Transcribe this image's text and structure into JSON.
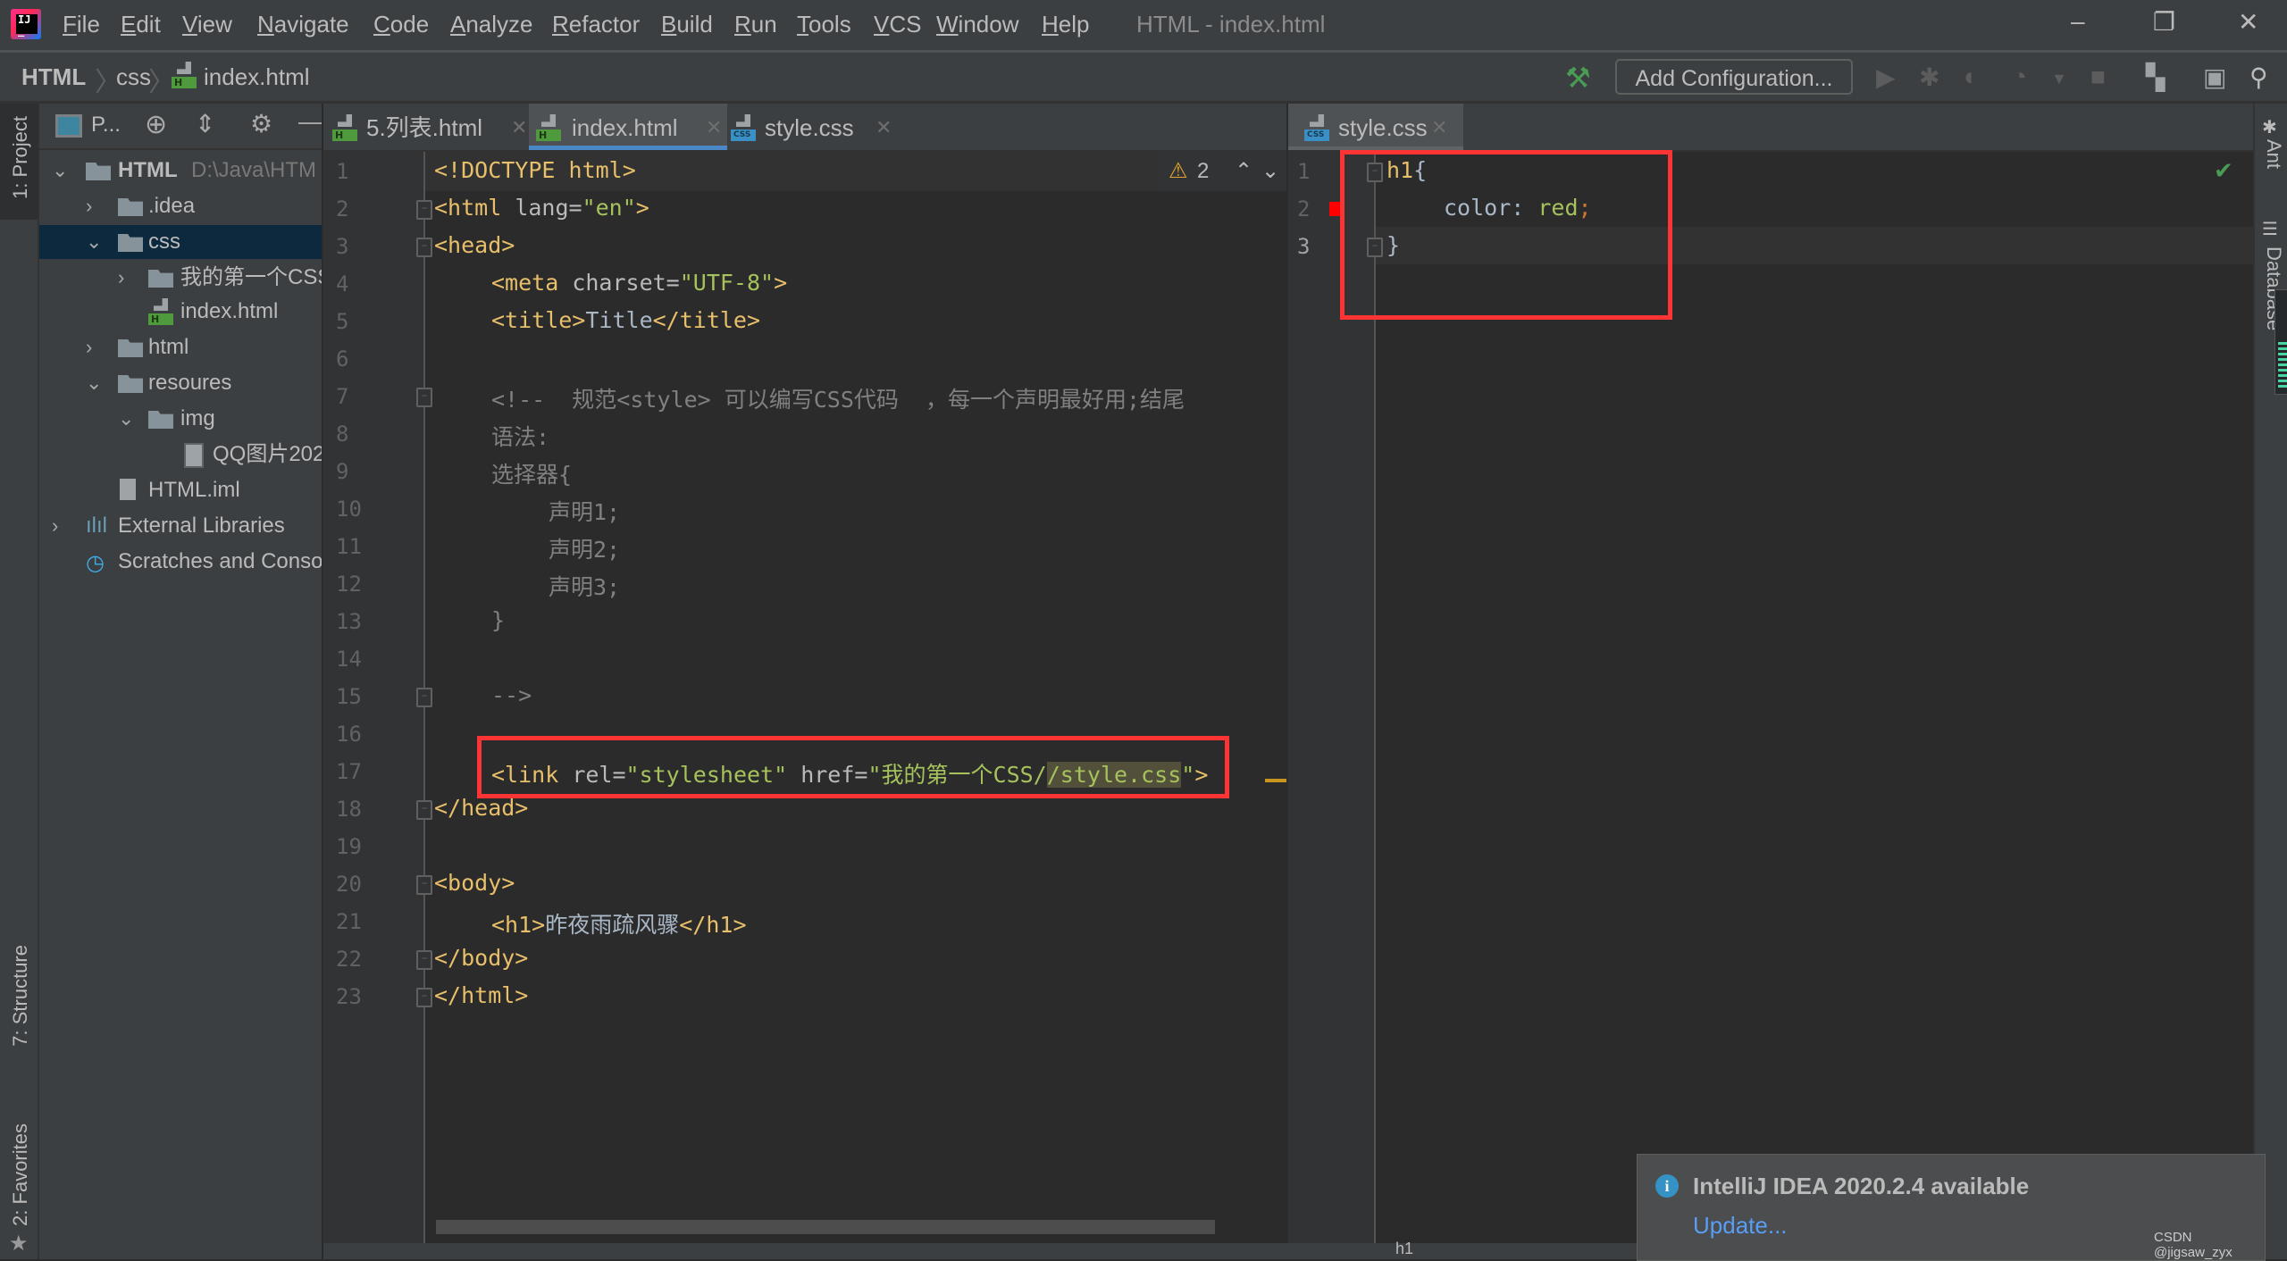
{
  "titlebar": {
    "logo": "intellij-logo",
    "menu": [
      "File",
      "Edit",
      "View",
      "Navigate",
      "Code",
      "Analyze",
      "Refactor",
      "Build",
      "Run",
      "Tools",
      "VCS",
      "Window",
      "Help"
    ],
    "window_title": "HTML - index.html",
    "controls": {
      "minimize": "–",
      "restore": "❐",
      "close": "✕"
    }
  },
  "navbar": {
    "breadcrumbs": [
      "HTML",
      "css",
      "index.html"
    ],
    "add_configuration": "Add Configuration...",
    "icons": [
      "build-hammer-icon",
      "run-icon",
      "debug-icon",
      "coverage-icon",
      "profile-icon",
      "stop-icon",
      "project-structure-icon",
      "terminal-icon",
      "search-icon"
    ]
  },
  "left_strip": {
    "project_tab": "1: Project",
    "structure_tab": "7: Structure",
    "favorites_tab": "2: Favorites"
  },
  "project_panel": {
    "view_selector": "P...",
    "tree": [
      {
        "label": "HTML",
        "path": "D:\\Java\\HTM",
        "level": 0,
        "expanded": true,
        "type": "module"
      },
      {
        "label": ".idea",
        "level": 1,
        "expanded": false,
        "type": "folder"
      },
      {
        "label": "css",
        "level": 1,
        "expanded": true,
        "type": "folder",
        "selected": true
      },
      {
        "label": "我的第一个CSS",
        "level": 2,
        "expanded": false,
        "type": "folder"
      },
      {
        "label": "index.html",
        "level": 2,
        "type": "html"
      },
      {
        "label": "html",
        "level": 1,
        "expanded": false,
        "type": "folder"
      },
      {
        "label": "resoures",
        "level": 1,
        "expanded": true,
        "type": "folder"
      },
      {
        "label": "img",
        "level": 2,
        "expanded": true,
        "type": "folder"
      },
      {
        "label": "QQ图片202",
        "level": 3,
        "type": "image"
      },
      {
        "label": "HTML.iml",
        "level": 1,
        "type": "iml"
      },
      {
        "label": "External Libraries",
        "level": 0,
        "expanded": false,
        "type": "libraries"
      },
      {
        "label": "Scratches and Conso",
        "level": 0,
        "type": "scratches"
      }
    ]
  },
  "editor_left": {
    "tabs": [
      {
        "label": "5.列表.html",
        "type": "html",
        "active": false
      },
      {
        "label": "index.html",
        "type": "html",
        "active": true
      },
      {
        "label": "style.css",
        "type": "css",
        "active": false
      }
    ],
    "warnings": "2",
    "line_numbers": [
      "1",
      "2",
      "3",
      "4",
      "5",
      "6",
      "7",
      "8",
      "9",
      "10",
      "11",
      "12",
      "13",
      "14",
      "15",
      "16",
      "17",
      "18",
      "19",
      "20",
      "21",
      "22",
      "23"
    ],
    "lines": {
      "l1": {
        "a": "<!DOCTYPE html>"
      },
      "l2": {
        "a": "<html ",
        "b": "lang=",
        "c": "\"en\"",
        "d": ">"
      },
      "l3": {
        "a": "<head>"
      },
      "l4": {
        "a": "<meta ",
        "b": "charset=",
        "c": "\"UTF-8\"",
        "d": ">"
      },
      "l5": {
        "a": "<title>",
        "b": "Title",
        "c": "</title>"
      },
      "l7": {
        "a": "<!--  规范<style> 可以编写CSS代码  ，每一个声明最好用;结尾"
      },
      "l8": {
        "a": "语法:"
      },
      "l9": {
        "a": "选择器{"
      },
      "l10": {
        "a": "声明1;"
      },
      "l11": {
        "a": "声明2;"
      },
      "l12": {
        "a": "声明3;"
      },
      "l13": {
        "a": "}"
      },
      "l15": {
        "a": "-->"
      },
      "l17": {
        "a": "<link ",
        "b": "rel=",
        "c": "\"stylesheet\"",
        "d": " href=",
        "e": "\"我的第一个CSS/",
        "f": "/style.css",
        "g": "\"",
        "h": ">"
      },
      "l18": {
        "a": "</head>"
      },
      "l20": {
        "a": "<body>"
      },
      "l21": {
        "a": "<h1>",
        "b": "昨夜雨疏风骤",
        "c": "</h1>"
      },
      "l22": {
        "a": "</body>"
      },
      "l23": {
        "a": "</html>"
      }
    }
  },
  "editor_right": {
    "tab": {
      "label": "style.css",
      "type": "css",
      "active": true
    },
    "line_numbers": [
      "1",
      "2",
      "3"
    ],
    "lines": {
      "l1": {
        "a": "h1",
        "b": "{"
      },
      "l2": {
        "a": "color: ",
        "b": "red",
        "c": ";"
      },
      "l3": {
        "a": "}"
      }
    },
    "color_swatch": "#ff0000"
  },
  "right_strip": {
    "ant": "Ant",
    "database": "Database"
  },
  "notification": {
    "title": "IntelliJ IDEA 2020.2.4 available",
    "link": "Update..."
  },
  "status_bar": {
    "breadcrumb": "h1"
  },
  "watermark": "CSDN @jigsaw_zyx",
  "colors": {
    "annotation_red": "#fc3434",
    "accent_blue": "#4a88c7",
    "tag": "#e8bf6a",
    "string": "#a5c25c"
  }
}
